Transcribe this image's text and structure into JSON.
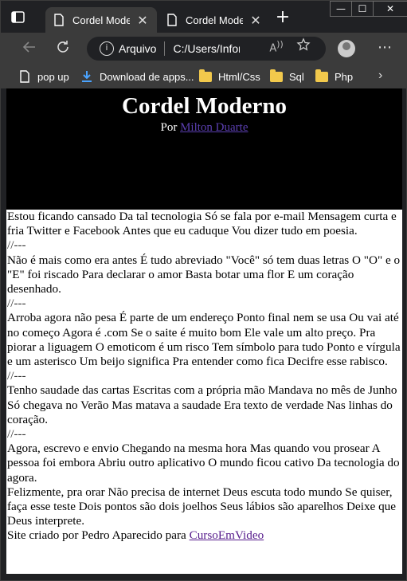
{
  "browser": {
    "tabs": [
      {
        "label": "Cordel Moderno",
        "close": "✕"
      },
      {
        "label": "Cordel Moderno",
        "close": "✕"
      }
    ],
    "new_tab": "+",
    "window_controls": {
      "minimize": "—",
      "maximize": "☐",
      "close": "✕"
    },
    "address": {
      "security_label": "Arquivo",
      "url": "C:/Users/Infor..."
    },
    "bookmarks": [
      {
        "label": "pop up",
        "icon": "page-icon"
      },
      {
        "label": "Download de apps...",
        "icon": "download-icon"
      },
      {
        "label": "Html/Css",
        "icon": "folder-icon"
      },
      {
        "label": "Sql",
        "icon": "folder-icon"
      },
      {
        "label": "Php",
        "icon": "folder-icon"
      }
    ]
  },
  "page": {
    "title": "Cordel Moderno",
    "byline_prefix": "Por",
    "author": "Milton Duarte",
    "separator": "//---",
    "stanzas": [
      "Estou ficando cansado Da tal tecnologia Só se fala por e-mail Mensagem curta e fria Twitter e Facebook Antes que eu caduque Vou dizer tudo em poesia.",
      "Não é mais como era antes É tudo abreviado \"Você\" só tem duas letras O \"O\" e o \"E\" foi riscado Para declarar o amor Basta botar uma flor E um coração desenhado.",
      "Arroba agora não pesa É parte de um endereço Ponto final nem se usa Ou vai até no começo Agora é .com Se o saite é muito bom Ele vale um alto preço. Pra piorar a liguagem O emoticom é um risco Tem símbolo para tudo Ponto e vírgula e um asterisco Um beijo significa Pra entender como fica Decifre esse rabisco.",
      "Tenho saudade das cartas Escritas com a própria mão Mandava no mês de Junho Só chegava no Verão Mas matava a saudade Era texto de verdade Nas linhas do coração.",
      "Agora, escrevo e envio Chegando na mesma hora Mas quando vou prosear A pessoa foi embora Abriu outro aplicativo O mundo ficou cativo Da tecnologia do agora.",
      "Felizmente, pra orar Não precisa de internet Deus escuta todo mundo Se quiser, faça esse teste Dois pontos são dois joelhos Seus lábios são aparelhos Deixe que Deus interprete."
    ],
    "footer_prefix": "Site criado por Pedro Aparecido para",
    "footer_link": "CursoEmVideo"
  }
}
